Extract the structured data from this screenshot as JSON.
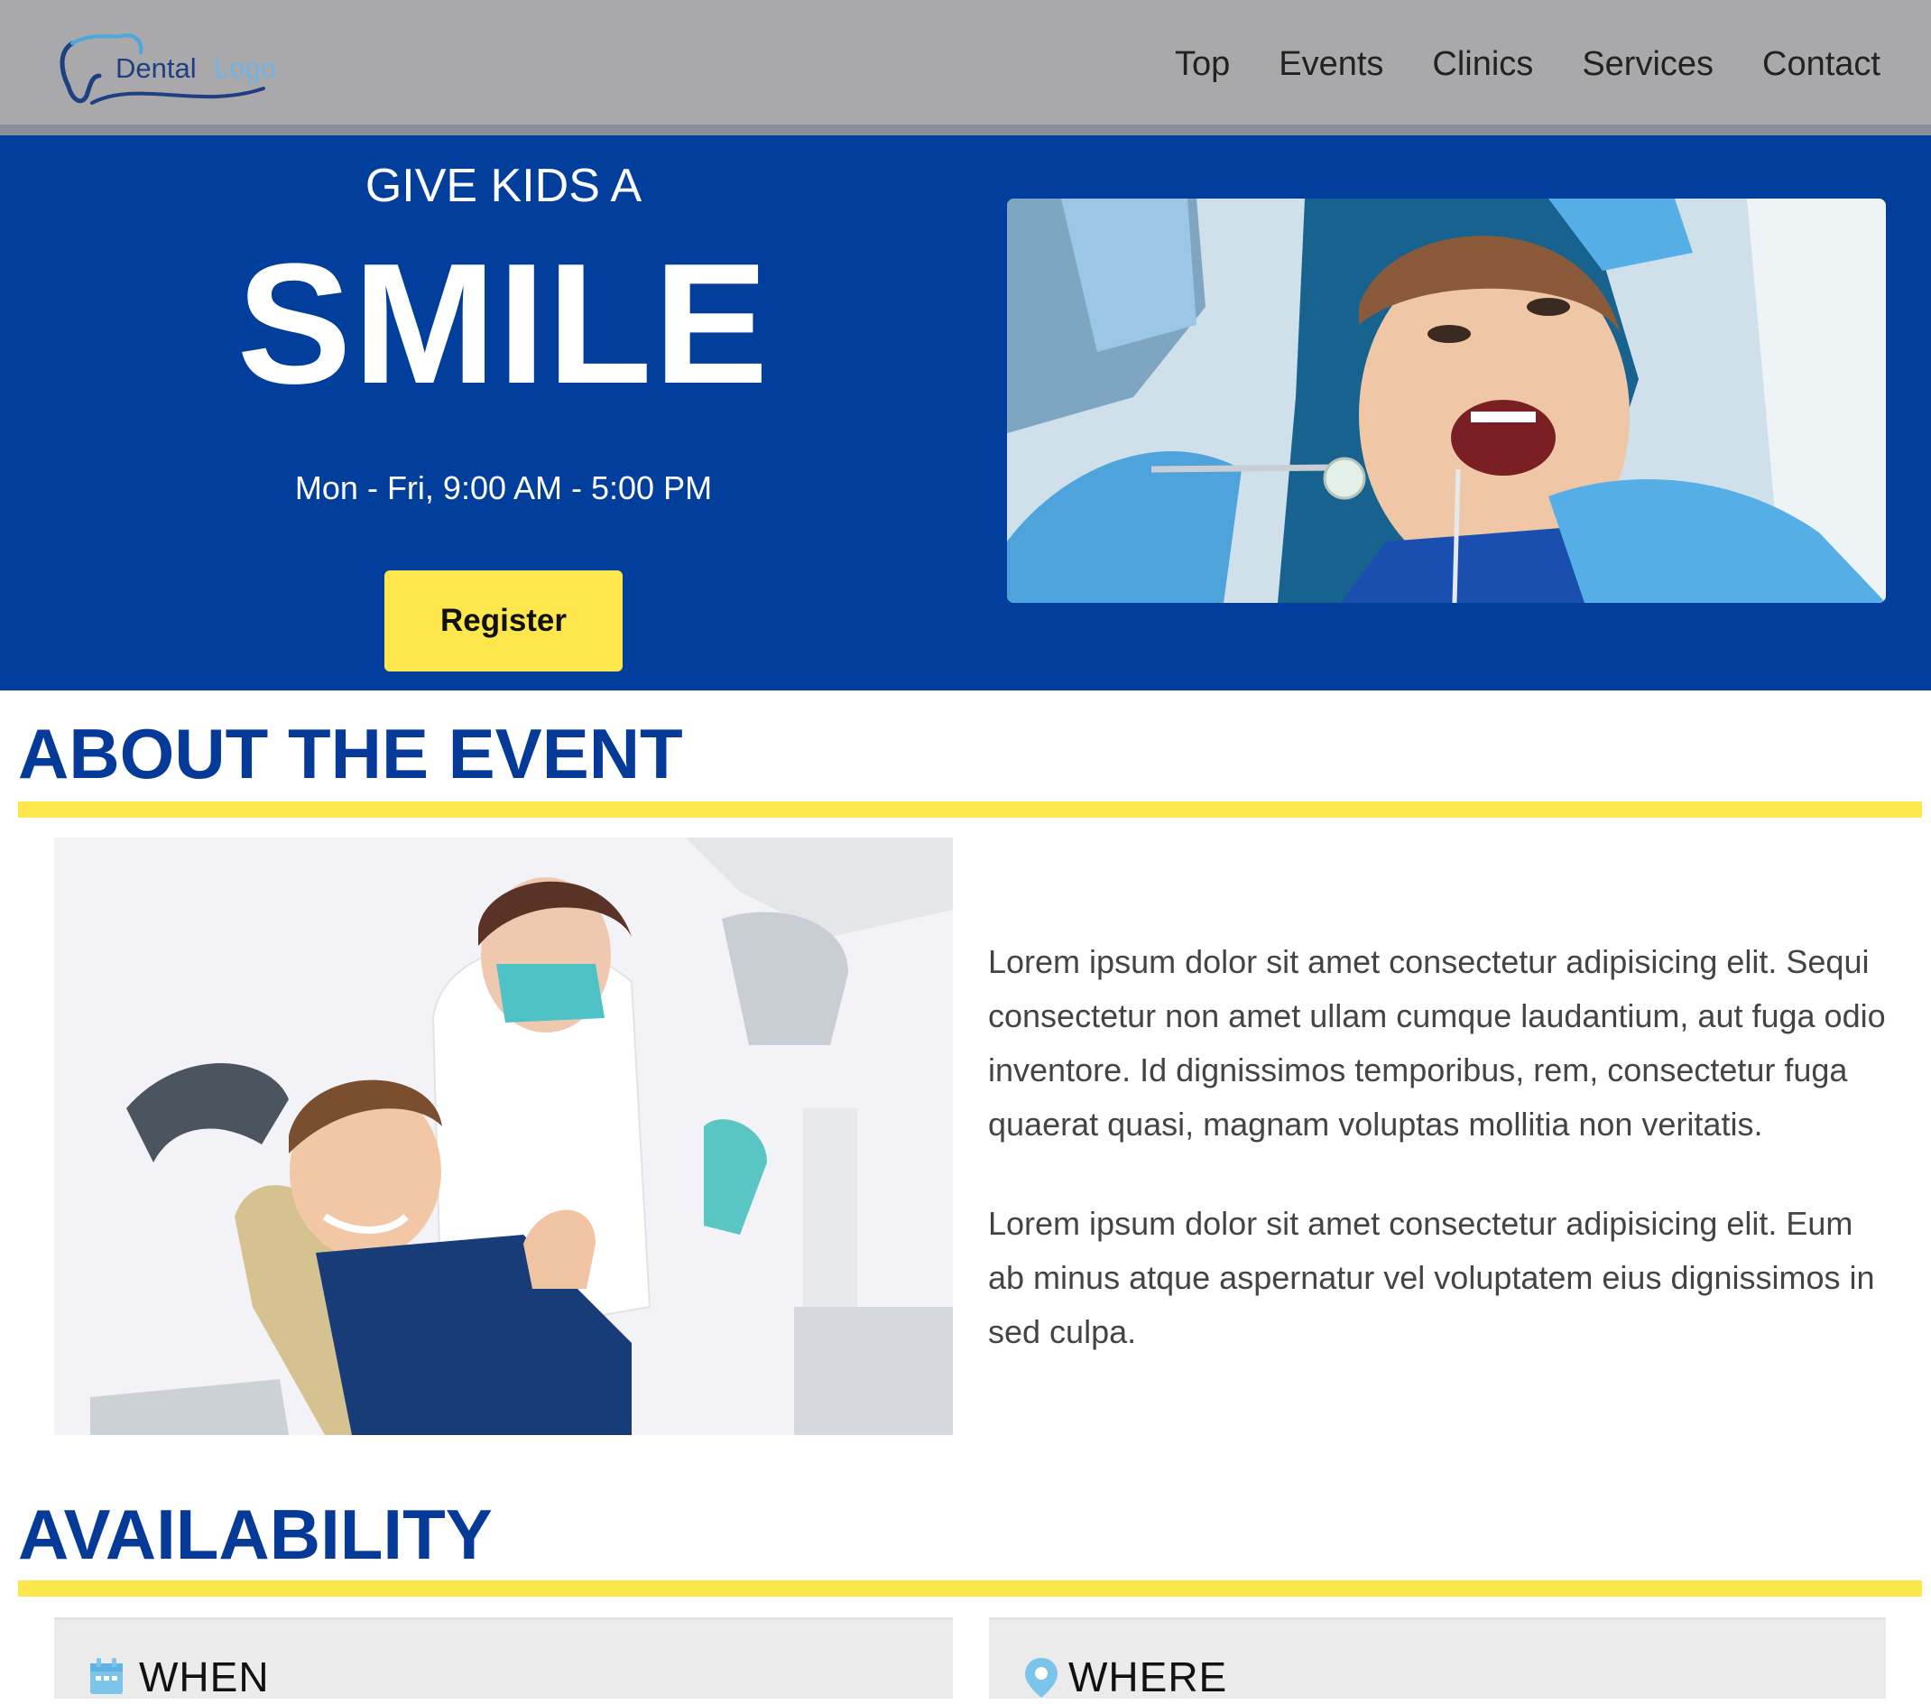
{
  "header": {
    "logo": {
      "word_1": "Dental",
      "word_2": "Logo"
    },
    "nav": [
      "Top",
      "Events",
      "Clinics",
      "Services",
      "Contact"
    ]
  },
  "hero": {
    "pre_title": "GIVE KIDS A",
    "title": "SMILE",
    "hours": "Mon - Fri, 9:00 AM - 5:00 PM",
    "register_label": "Register"
  },
  "about": {
    "title": "ABOUT THE EVENT",
    "paragraphs": [
      "Lorem ipsum dolor sit amet consectetur adipisicing elit. Sequi consectetur non amet ullam cumque laudantium, aut fuga odio inventore. Id dignissimos temporibus, rem, consectetur fuga quaerat quasi, magnam voluptas mollitia non veritatis.",
      "Lorem ipsum dolor sit amet consectetur adipisicing elit. Eum ab minus atque aspernatur vel voluptatem eius dignissimos in sed culpa."
    ]
  },
  "availability": {
    "title": "AVAILABILITY",
    "cards": [
      {
        "title": "WHEN",
        "icon": "calendar-icon"
      },
      {
        "title": "WHERE",
        "icon": "map-pin-icon"
      }
    ]
  },
  "colors": {
    "header_bg": "#a9a9ab",
    "hero_bg": "#023e9c",
    "accent_yellow": "#fde74c",
    "heading_blue": "#053a98"
  }
}
